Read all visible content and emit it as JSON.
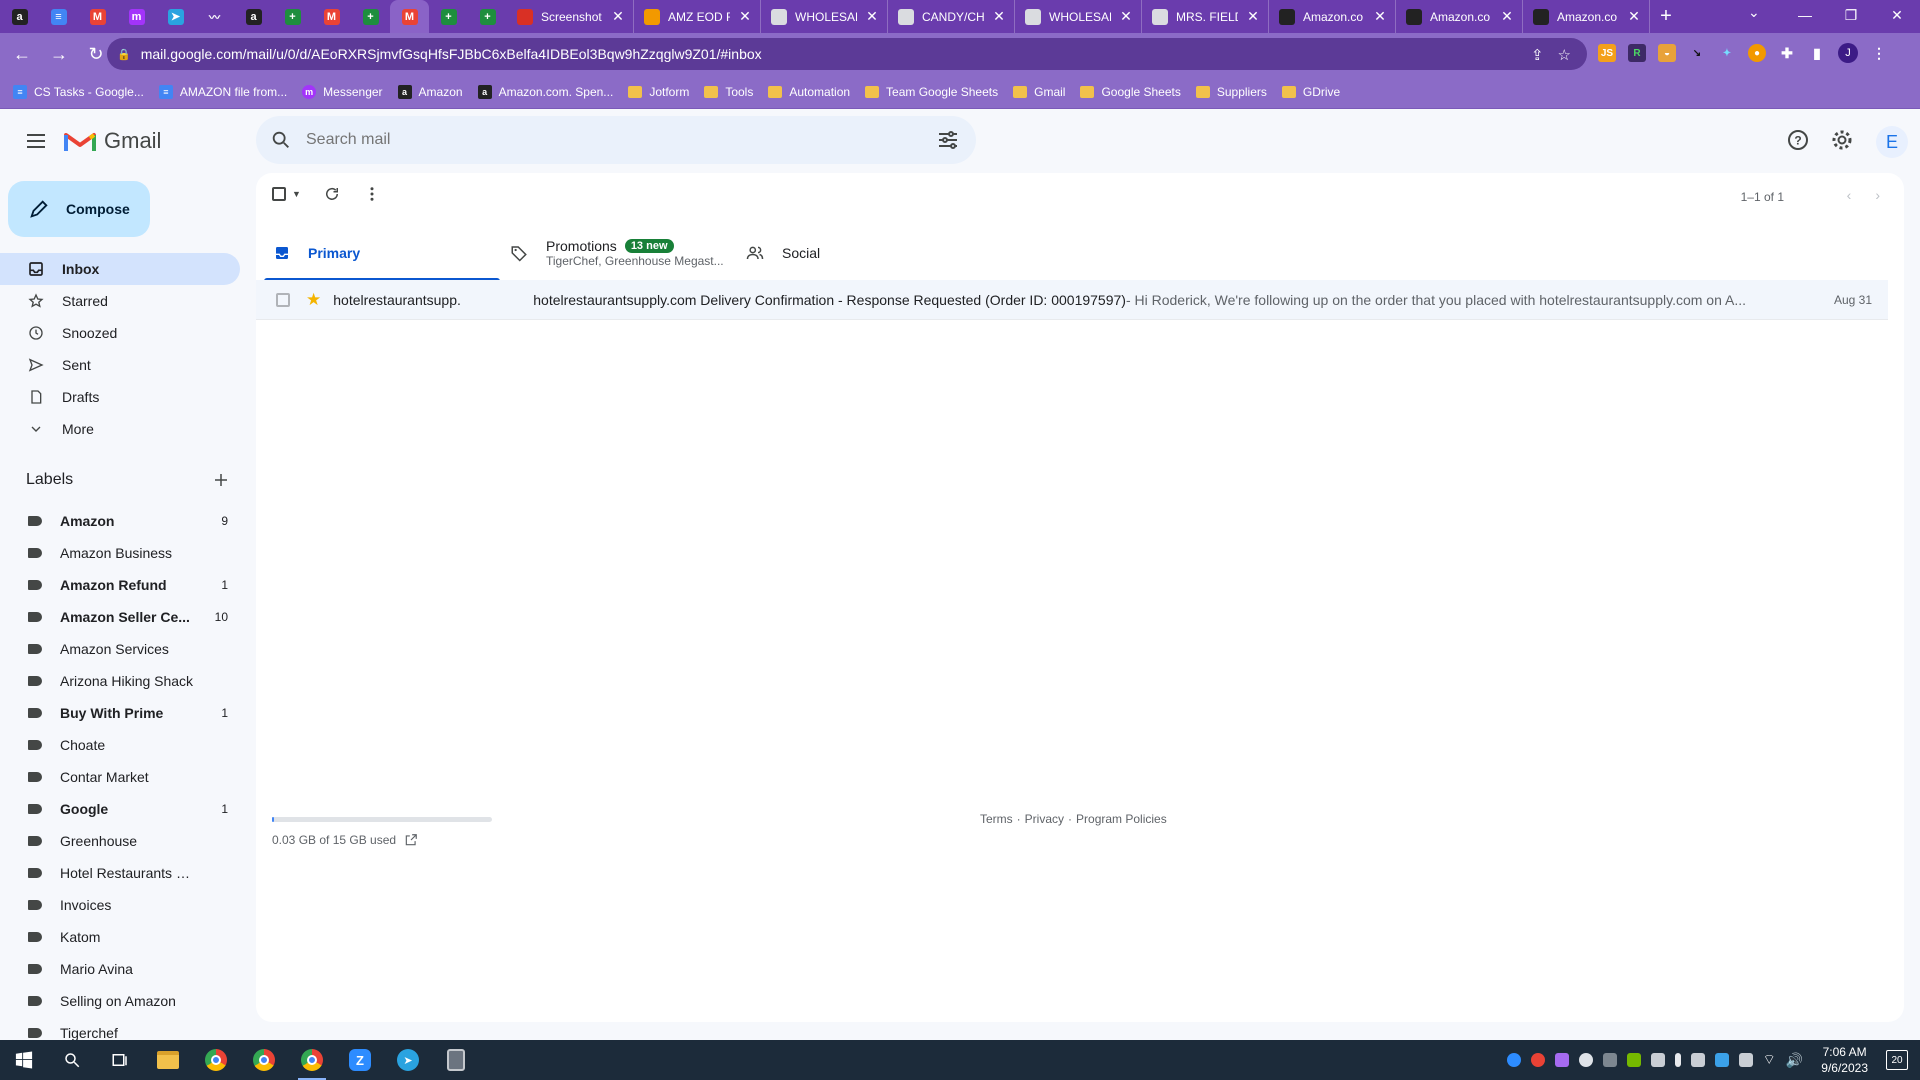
{
  "browser": {
    "pinned_tabs": [
      {
        "icon": "amazon-icon",
        "letter": "a",
        "color": "#222222"
      },
      {
        "icon": "google-docs-icon",
        "letter": "≡",
        "color": "#4285f4"
      },
      {
        "icon": "gmail-icon",
        "letter": "M",
        "color": "#ea4335"
      },
      {
        "icon": "messenger-icon",
        "letter": "m",
        "color": "#a334fa"
      },
      {
        "icon": "telegram-icon",
        "letter": "➤",
        "color": "#2aa3e0"
      },
      {
        "icon": "analytics-icon",
        "letter": "〰",
        "color": "#6a3cad"
      },
      {
        "icon": "amazon-icon",
        "letter": "a",
        "color": "#222222"
      },
      {
        "icon": "google-sheets-icon",
        "letter": "+",
        "color": "#1e8e3e"
      },
      {
        "icon": "gmail-icon",
        "letter": "M",
        "color": "#ea4335"
      },
      {
        "icon": "google-sheets-icon",
        "letter": "+",
        "color": "#1e8e3e"
      },
      {
        "icon": "gmail-icon",
        "letter": "M",
        "color": "#ea4335"
      },
      {
        "icon": "google-sheets-icon",
        "letter": "+",
        "color": "#1e8e3e"
      },
      {
        "icon": "google-sheets-icon",
        "letter": "+",
        "color": "#1e8e3e"
      }
    ],
    "tabs": [
      {
        "title": "Screenshot",
        "icon": "screenshot-icon",
        "color": "#d93025"
      },
      {
        "title": "AMZ EOD R",
        "icon": "amz-icon",
        "color": "#f29900"
      },
      {
        "title": "WHOLESAL",
        "icon": "page-icon",
        "color": "#dadce0"
      },
      {
        "title": "CANDY/CH",
        "icon": "page-icon",
        "color": "#dadce0"
      },
      {
        "title": "WHOLESAL",
        "icon": "page-icon",
        "color": "#dadce0"
      },
      {
        "title": "MRS. FIELD",
        "icon": "page-icon",
        "color": "#dadce0"
      },
      {
        "title": "Amazon.co",
        "icon": "amazon-icon",
        "color": "#222222"
      },
      {
        "title": "Amazon.co",
        "icon": "amazon-icon",
        "color": "#222222"
      },
      {
        "title": "Amazon.co",
        "icon": "amazon-icon",
        "color": "#222222"
      }
    ],
    "url": "mail.google.com/mail/u/0/d/AEoRXRSjmvfGsqHfsFJBbC6xBelfa4IDBEol3Bqw9hZzqglw9Z01/#inbox",
    "profile_letter": "J",
    "bookmarks": [
      {
        "label": "CS Tasks - Google...",
        "type": "docs"
      },
      {
        "label": "AMAZON file from...",
        "type": "docs"
      },
      {
        "label": "Messenger",
        "type": "messenger"
      },
      {
        "label": "Amazon",
        "type": "amazon"
      },
      {
        "label": "Amazon.com. Spen...",
        "type": "amazon"
      },
      {
        "label": "Jotform",
        "type": "folder"
      },
      {
        "label": "Tools",
        "type": "folder"
      },
      {
        "label": "Automation",
        "type": "folder"
      },
      {
        "label": "Team Google Sheets",
        "type": "folder"
      },
      {
        "label": "Gmail",
        "type": "folder"
      },
      {
        "label": "Google Sheets",
        "type": "folder"
      },
      {
        "label": "Suppliers",
        "type": "folder"
      },
      {
        "label": "GDrive",
        "type": "folder"
      }
    ]
  },
  "gmail": {
    "logo_text": "Gmail",
    "search_placeholder": "Search mail",
    "avatar_letter": "E",
    "compose_label": "Compose",
    "nav": [
      {
        "label": "Inbox",
        "icon": "inbox-icon",
        "active": true
      },
      {
        "label": "Starred",
        "icon": "star-icon"
      },
      {
        "label": "Snoozed",
        "icon": "clock-icon"
      },
      {
        "label": "Sent",
        "icon": "send-icon"
      },
      {
        "label": "Drafts",
        "icon": "draft-icon"
      },
      {
        "label": "More",
        "icon": "chevron-down-icon"
      }
    ],
    "labels_heading": "Labels",
    "labels": [
      {
        "name": "Amazon",
        "count": "9",
        "bold": true
      },
      {
        "name": "Amazon Business",
        "count": "",
        "bold": false
      },
      {
        "name": "Amazon Refund",
        "count": "1",
        "bold": true
      },
      {
        "name": "Amazon Seller Ce...",
        "count": "10",
        "bold": true
      },
      {
        "name": "Amazon Services",
        "count": "",
        "bold": false
      },
      {
        "name": "Arizona Hiking Shack",
        "count": "",
        "bold": false
      },
      {
        "name": "Buy With Prime",
        "count": "1",
        "bold": true
      },
      {
        "name": "Choate",
        "count": "",
        "bold": false
      },
      {
        "name": "Contar Market",
        "count": "",
        "bold": false
      },
      {
        "name": "Google",
        "count": "1",
        "bold": true
      },
      {
        "name": "Greenhouse",
        "count": "",
        "bold": false
      },
      {
        "name": "Hotel Restaurants Supply",
        "count": "",
        "bold": false
      },
      {
        "name": "Invoices",
        "count": "",
        "bold": false
      },
      {
        "name": "Katom",
        "count": "",
        "bold": false
      },
      {
        "name": "Mario Avina",
        "count": "",
        "bold": false
      },
      {
        "name": "Selling on Amazon",
        "count": "",
        "bold": false
      },
      {
        "name": "Tigerchef",
        "count": "",
        "bold": false
      }
    ],
    "pager": "1–1 of 1",
    "tabs": [
      {
        "label": "Primary",
        "icon": "inbox-icon",
        "active": true,
        "sub": "",
        "badge": ""
      },
      {
        "label": "Promotions",
        "icon": "tag-icon",
        "sub": "TigerChef, Greenhouse Megast...",
        "badge": "13 new"
      },
      {
        "label": "Social",
        "icon": "people-icon",
        "sub": "",
        "badge": ""
      }
    ],
    "email": {
      "sender": "hotelrestaurantsupp.",
      "subject": "hotelrestaurantsupply.com Delivery Confirmation - Response Requested (Order ID: 000197597)",
      "snippet": " - Hi Roderick, We're following up on the order that you placed with hotelrestaurantsupply.com on A...",
      "date": "Aug 31",
      "starred": true
    },
    "storage": {
      "text": "0.03 GB of 15 GB used",
      "fraction": 0.002
    },
    "footer": {
      "terms": "Terms",
      "privacy": "Privacy",
      "policies": "Program Policies",
      "sep": "·"
    }
  },
  "taskbar": {
    "time": "7:06 AM",
    "date": "9/6/2023",
    "notification_count": "20",
    "apps": [
      {
        "icon": "windows-start-icon"
      },
      {
        "icon": "search-icon"
      },
      {
        "icon": "task-view-icon"
      },
      {
        "icon": "file-explorer-icon"
      },
      {
        "icon": "chrome-icon"
      },
      {
        "icon": "chrome-icon"
      },
      {
        "icon": "chrome-icon",
        "active": true
      },
      {
        "icon": "zoom-icon"
      },
      {
        "icon": "telegram-icon"
      },
      {
        "icon": "calculator-icon"
      }
    ]
  },
  "colors": {
    "chrome_frame": "#6a3cad",
    "gmail_active": "#d3e3fd",
    "compose": "#c2e7ff",
    "primary_blue": "#0b57d0",
    "badge_green": "#188038"
  }
}
